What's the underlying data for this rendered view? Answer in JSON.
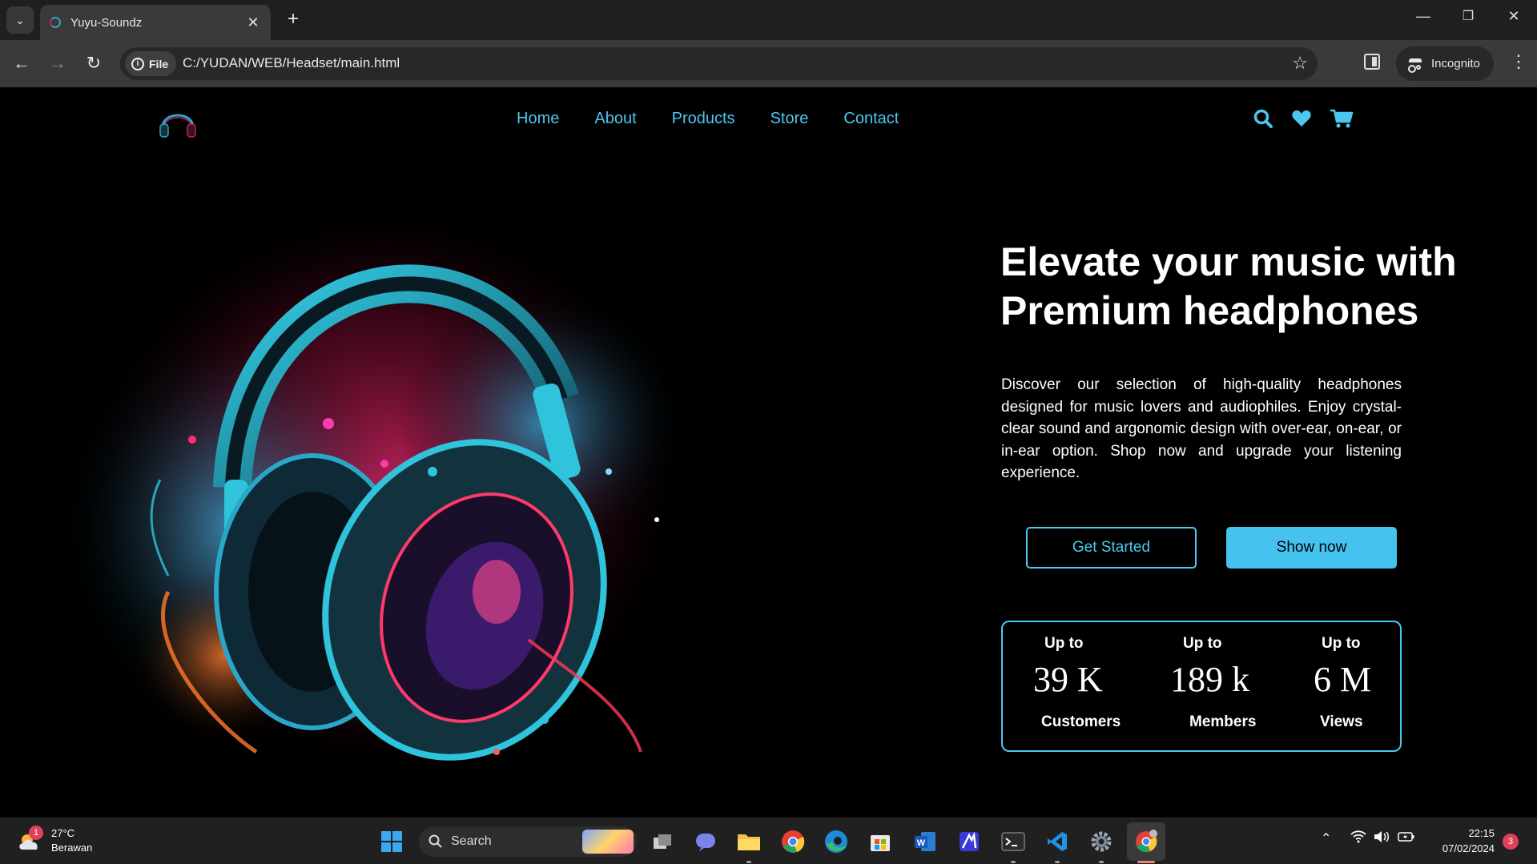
{
  "browser": {
    "tab_title": "Yuyu-Soundz",
    "tab_close": "✕",
    "new_tab": "+",
    "security_chip": "File",
    "url": "C:/YUDAN/WEB/Headset/main.html",
    "profile_label": "Incognito",
    "window_controls": {
      "minimize": "—",
      "restore": "❐",
      "close": "✕"
    }
  },
  "site": {
    "nav": [
      "Home",
      "About",
      "Products",
      "Store",
      "Contact"
    ],
    "icons": [
      "search-icon",
      "heart-icon",
      "cart-icon"
    ],
    "accent": "#4cc7ef",
    "hero": {
      "headline": "Elevate your music with Premium headphones",
      "description": "Discover our selection of high-quality headphones designed for music lovers and audiophiles. Enjoy crystal-clear sound and argonomic design with over-ear, on-ear, or in-ear option. Shop now and upgrade your listening experience.",
      "cta_secondary": "Get Started",
      "cta_primary": "Show now"
    },
    "stats": [
      {
        "prefix": "Up to",
        "value": "39 K",
        "label": "Customers"
      },
      {
        "prefix": "Up to",
        "value": "189 k",
        "label": "Members"
      },
      {
        "prefix": "Up to",
        "value": "6 M",
        "label": "Views"
      }
    ]
  },
  "taskbar": {
    "weather_temp": "27°C",
    "weather_desc": "Berawan",
    "weather_badge": "1",
    "search_label": "Search",
    "time": "22:15",
    "date": "07/02/2024",
    "notifications": "3"
  }
}
